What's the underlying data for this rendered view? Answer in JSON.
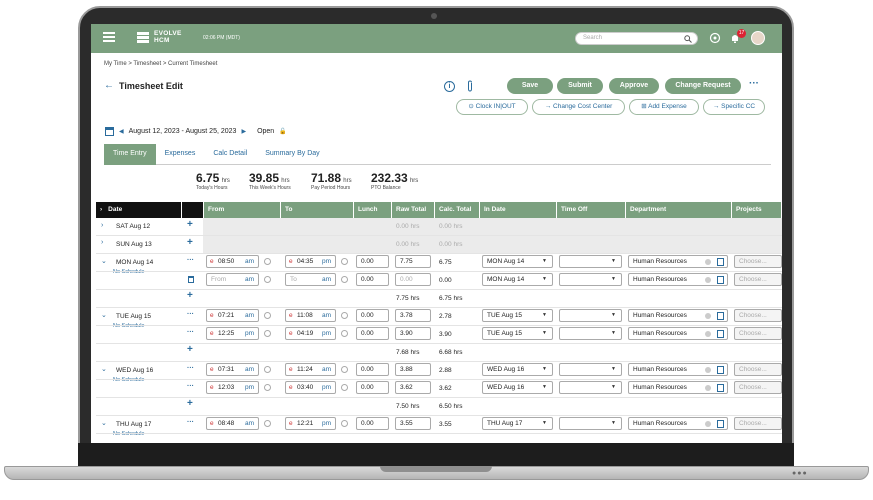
{
  "header": {
    "logo_line1": "EVOLVE",
    "logo_line2": "HCM",
    "time": "02:06 PM (MDT)",
    "search_placeholder": "Search",
    "notification_count": "17"
  },
  "breadcrumb": "My Time > Timesheet > Current Timesheet",
  "page_title": "Timesheet Edit",
  "actions": {
    "save": "Save",
    "submit": "Submit",
    "approve": "Approve",
    "change_request": "Change Request",
    "clock": "Clock IN|OUT",
    "cost_center": "Change Cost Center",
    "add_expense": "Add Expense",
    "specific_cc": "Specific CC"
  },
  "period": {
    "range": "August 12, 2023 - August 25, 2023",
    "status": "Open"
  },
  "tabs": [
    "Time Entry",
    "Expenses",
    "Calc Detail",
    "Summary By Day"
  ],
  "summary": [
    {
      "value": "6.75",
      "unit": "hrs",
      "label": "Today's Hours"
    },
    {
      "value": "39.85",
      "unit": "hrs",
      "label": "This Week's Hours"
    },
    {
      "value": "71.88",
      "unit": "hrs",
      "label": "Pay Period Hours"
    },
    {
      "value": "232.33",
      "unit": "hrs",
      "label": "PTO Balance"
    }
  ],
  "columns": {
    "date": "Date",
    "from": "From",
    "to": "To",
    "lunch": "Lunch",
    "raw_total": "Raw Total",
    "calc_total": "Calc. Total",
    "in_date": "In Date",
    "time_off": "Time Off",
    "department": "Department",
    "projects": "Projects"
  },
  "common": {
    "zero_hrs": "0.00 hrs",
    "no_schedule": "No Schedule",
    "from_ph": "From",
    "to_ph": "To",
    "am": "am",
    "pm": "pm",
    "e": "e",
    "zero": "0.00",
    "choose": "Choose...",
    "department": "Human Resources",
    "plus": "+",
    "more": "···"
  },
  "days": [
    {
      "date": "SAT Aug 12"
    },
    {
      "date": "SUN Aug 13"
    },
    {
      "date": "MON Aug 14",
      "entries": [
        {
          "from": "08:50",
          "from_ap": "am",
          "to": "04:35",
          "to_ap": "pm",
          "lunch": "0.00",
          "raw": "7.75",
          "calc": "6.75",
          "in_date": "MON Aug 14"
        },
        {
          "from": "",
          "from_ap": "am",
          "to": "",
          "to_ap": "am",
          "lunch": "0.00",
          "raw": "0.00",
          "calc": "0.00",
          "in_date": "MON Aug 14"
        }
      ],
      "raw_total": "7.75 hrs",
      "calc_total": "6.75 hrs"
    },
    {
      "date": "TUE Aug 15",
      "entries": [
        {
          "from": "07:21",
          "from_ap": "am",
          "to": "11:08",
          "to_ap": "am",
          "lunch": "0.00",
          "raw": "3.78",
          "calc": "2.78",
          "in_date": "TUE Aug 15"
        },
        {
          "from": "12:25",
          "from_ap": "pm",
          "to": "04:19",
          "to_ap": "pm",
          "lunch": "0.00",
          "raw": "3.90",
          "calc": "3.90",
          "in_date": "TUE Aug 15"
        }
      ],
      "raw_total": "7.68 hrs",
      "calc_total": "6.68 hrs"
    },
    {
      "date": "WED Aug 16",
      "entries": [
        {
          "from": "07:31",
          "from_ap": "am",
          "to": "11:24",
          "to_ap": "am",
          "lunch": "0.00",
          "raw": "3.88",
          "calc": "2.88",
          "in_date": "WED Aug 16"
        },
        {
          "from": "12:03",
          "from_ap": "pm",
          "to": "03:40",
          "to_ap": "pm",
          "lunch": "0.00",
          "raw": "3.62",
          "calc": "3.62",
          "in_date": "WED Aug 16"
        }
      ],
      "raw_total": "7.50 hrs",
      "calc_total": "6.50 hrs"
    },
    {
      "date": "THU Aug 17",
      "entries": [
        {
          "from": "08:48",
          "from_ap": "am",
          "to": "12:21",
          "to_ap": "pm",
          "lunch": "0.00",
          "raw": "3.55",
          "calc": "3.55",
          "in_date": "THU Aug 17"
        }
      ]
    }
  ]
}
